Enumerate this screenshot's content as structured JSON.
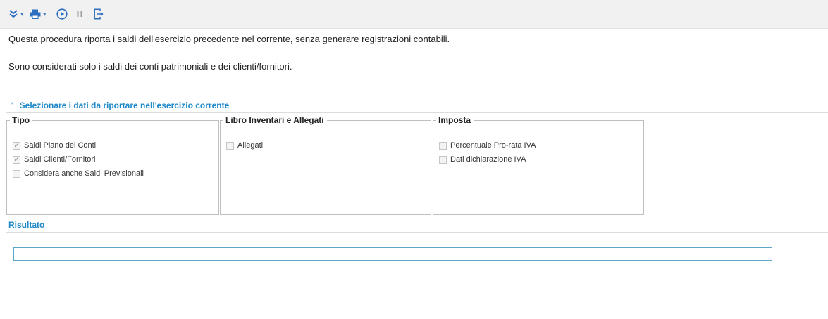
{
  "toolbar": {
    "buttons": [
      {
        "icon": "double-chevron-down-icon",
        "dropdown": true
      },
      {
        "icon": "printer-icon",
        "dropdown": true
      },
      {
        "icon": "play-icon"
      },
      {
        "icon": "pause-icon"
      },
      {
        "icon": "exit-icon"
      }
    ]
  },
  "intro": {
    "line1": "Questa procedura riporta i saldi dell'esercizio precedente nel corrente, senza generare registrazioni contabili.",
    "line2": "Sono considerati solo i saldi dei conti patrimoniali e dei clienti/fornitori."
  },
  "section": {
    "title": "Selezionare i dati da riportare nell'esercizio corrente",
    "groups": [
      {
        "title": "Tipo",
        "options": [
          {
            "label": "Saldi Piano dei Conti",
            "checked": true
          },
          {
            "label": "Saldi Clienti/Fornitori",
            "checked": true
          },
          {
            "label": "Considera anche Saldi Previsionali",
            "checked": false
          }
        ]
      },
      {
        "title": "Libro Inventari e Allegati",
        "options": [
          {
            "label": "Allegati",
            "checked": false
          }
        ]
      },
      {
        "title": "Imposta",
        "options": [
          {
            "label": "Percentuale Pro-rata IVA",
            "checked": false
          },
          {
            "label": "Dati dichiarazione IVA",
            "checked": false
          }
        ]
      }
    ]
  },
  "result": {
    "label": "Risultato",
    "value": ""
  },
  "colors": {
    "accent": "#1e88c8",
    "icon_blue": "#2f6fc0",
    "left_border": "#2e7d32"
  }
}
